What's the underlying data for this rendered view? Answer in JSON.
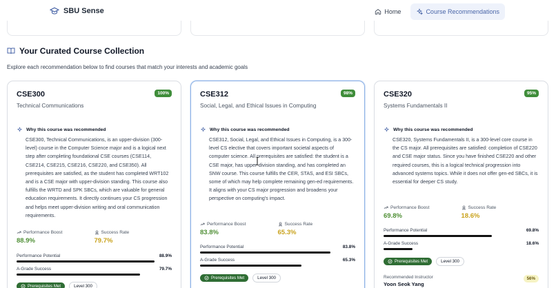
{
  "header": {
    "brand": "SBU Sense",
    "nav": [
      {
        "label": "Home",
        "icon": "home-icon",
        "active": false
      },
      {
        "label": "Course Recommendations",
        "icon": "sparkles-icon",
        "active": true
      }
    ]
  },
  "section": {
    "title": "Your Curated Course Collection",
    "subtitle": "Explore each recommendation below to find courses that match your interests and academic goals"
  },
  "labels": {
    "why": "Why this course was recommended",
    "performance_boost": "Performance Boost",
    "success_rate": "Success Rate",
    "performance_potential": "Performance Potential",
    "a_grade_success": "A-Grade Success",
    "prereqs_met": "Prerequisites Met",
    "recommended_instructor": "Recommended Instructor"
  },
  "colors": {
    "accent": "#4a66a8",
    "match_badge": "#3f8d3a",
    "boost_green": "#4f8f35",
    "success_gold": "#c9a21c",
    "prereq_tag": "#2f6d34"
  },
  "cards": [
    {
      "code": "CSE300",
      "name": "Technical Communications",
      "match": "100%",
      "reason": "CSE300, Technical Communications, is an upper-division (300-level) course in the Computer Science major and is a logical next step after completing foundational CSE courses (CSE114, CSE214, CSE215, CSE216, CSE220, and CSE350). All prerequisites are satisfied, as the student has completed WRT102 and is a CSE major with upper-division standing. This course also fulfills the WRTD and SPK SBCs, which are valuable for general education requirements. It directly continues your CS progression and helps meet upper-division writing and oral communication requirements.",
      "boost": "88.9%",
      "success": "79.7%",
      "potential": "88.9%",
      "potential_value": 0.889,
      "agrade": "79.7%",
      "agrade_value": 0.797,
      "level": "Level 300"
    },
    {
      "code": "CSE312",
      "name": "Social, Legal, and Ethical Issues in Computing",
      "match": "98%",
      "reason": "CSE312, Social, Legal, and Ethical Issues in Computing, is a 300-level CS elective that covers important societal aspects of computer science. All prerequisites are satisfied: the student is a CSE major, has upper-division standing, and has completed an SNW course. This course fulfills the CER, STAS, and ESI SBCs, some of which may help complete remaining gen-ed requirements. It aligns with your CS major progression and broadens your perspective on computing's impact.",
      "boost": "83.8%",
      "success": "65.3%",
      "potential": "83.8%",
      "potential_value": 0.838,
      "agrade": "65.3%",
      "agrade_value": 0.653,
      "level": "Level 300"
    },
    {
      "code": "CSE320",
      "name": "Systems Fundamentals II",
      "match": "95%",
      "reason": "CSE320, Systems Fundamentals II, is a 300-level core course in the CS major. All prerequisites are satisfied: completion of CSE220 and CSE major status. Since you have finished CSE220 and other required courses, this is a logical technical progression into advanced systems topics. While it does not offer gen-ed SBCs, it is essential for deeper CS study.",
      "boost": "69.8%",
      "success": "18.6%",
      "potential": "69.8%",
      "potential_value": 0.698,
      "agrade": "18.6%",
      "agrade_value": 0.186,
      "level": "Level 300",
      "instructor": "Yoon Seok Yang",
      "instructor_pct": "56%"
    }
  ]
}
